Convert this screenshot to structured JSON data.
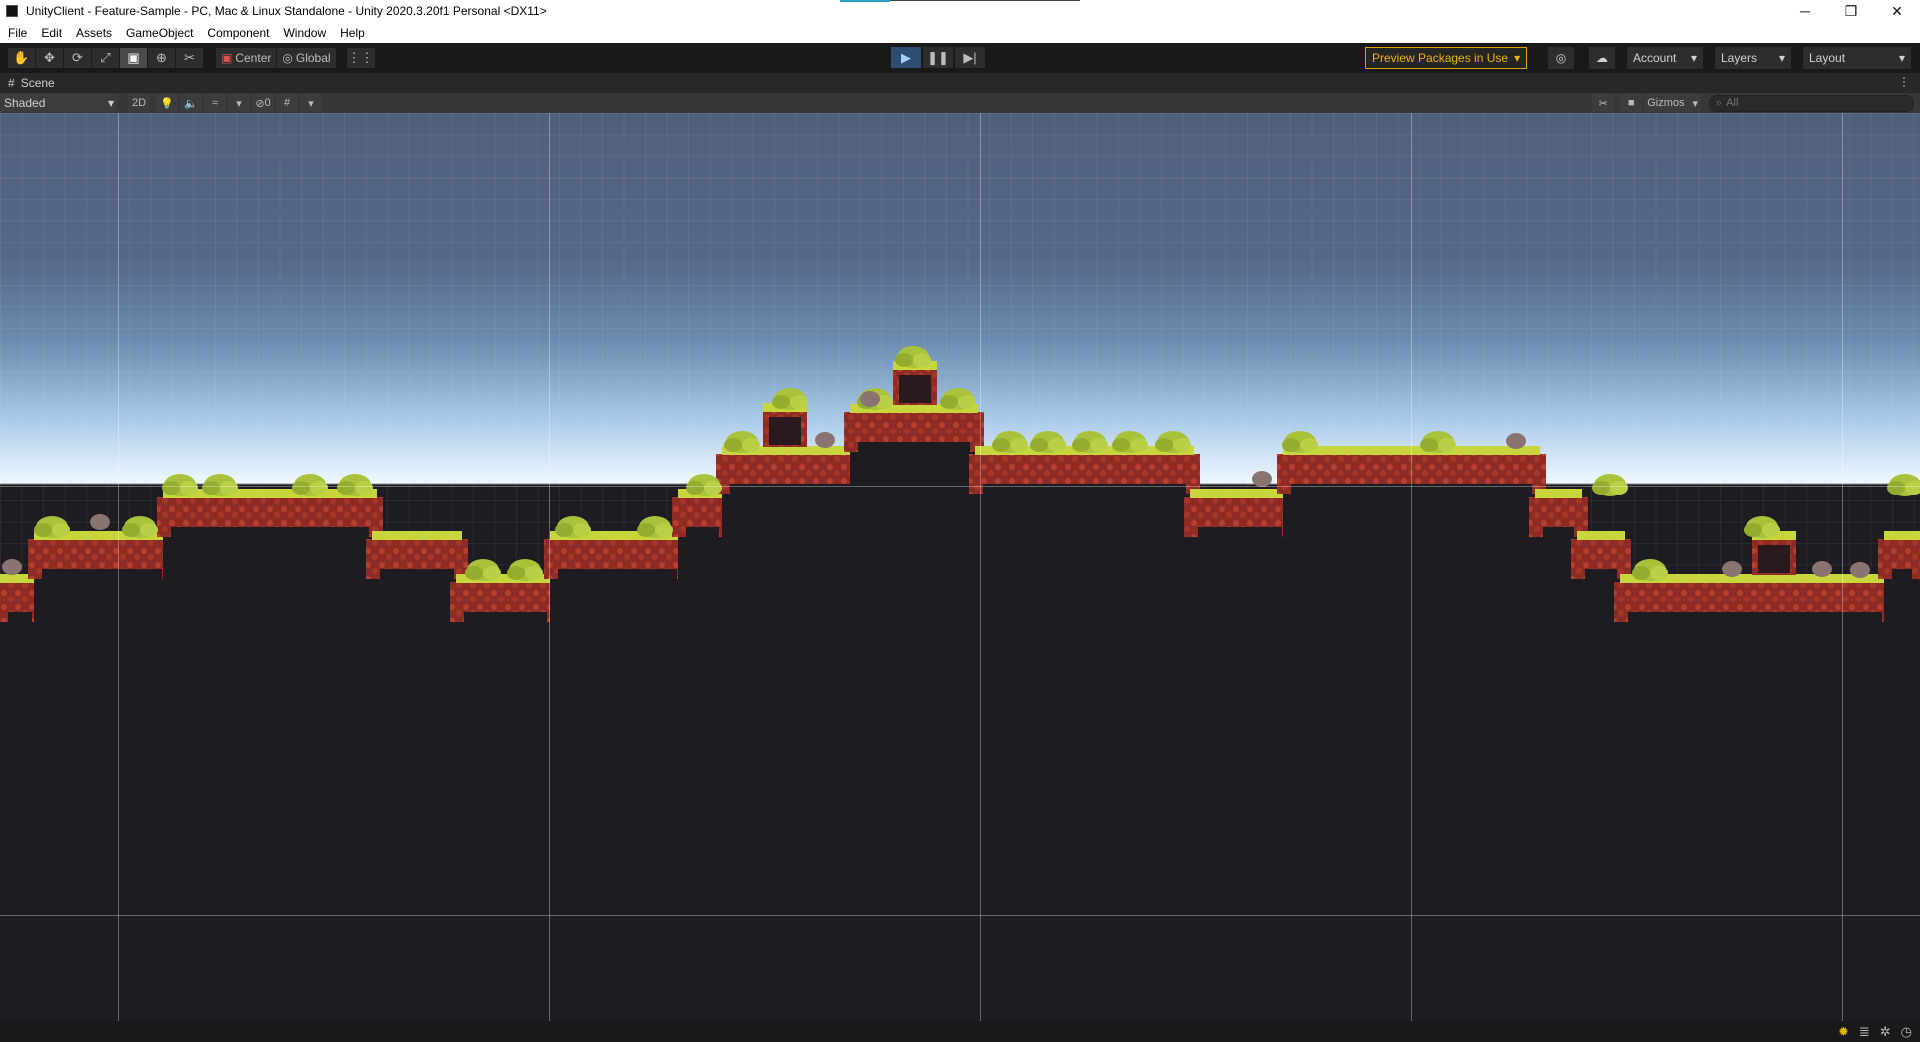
{
  "window": {
    "title": "UnityClient - Feature-Sample - PC, Mac & Linux Standalone - Unity 2020.3.20f1 Personal <DX11>",
    "controls": {
      "minimize": "─",
      "maximize": "❐",
      "close": "✕"
    }
  },
  "menu": {
    "items": [
      "File",
      "Edit",
      "Assets",
      "GameObject",
      "Component",
      "Window",
      "Help"
    ]
  },
  "toolbar": {
    "tools": [
      {
        "name": "hand-tool-icon",
        "glyph": "✋"
      },
      {
        "name": "move-tool-icon",
        "glyph": "✥"
      },
      {
        "name": "rotate-tool-icon",
        "glyph": "⟳"
      },
      {
        "name": "scale-tool-icon",
        "glyph": "⤢"
      },
      {
        "name": "rect-tool-icon",
        "glyph": "▣"
      },
      {
        "name": "transform-tool-icon",
        "glyph": "⊕"
      },
      {
        "name": "custom-tool-icon",
        "glyph": "✂"
      }
    ],
    "selected_tool": 4,
    "pivot_label": "Center",
    "space_label": "Global",
    "snap_glyph": "⋮⋮",
    "play_glyph": "▶",
    "pause_glyph": "❚❚",
    "step_glyph": "▶|",
    "preview_packages": "Preview Packages in Use",
    "account": "Account",
    "layers": "Layers",
    "layout": "Layout",
    "dropdown_glyph": "▾",
    "collab_glyph": "◎",
    "cloud_glyph": "☁"
  },
  "scene": {
    "tab_label": "Scene",
    "tab_glyph": "#",
    "more_glyph": "⋮",
    "shading_mode": "Shaded",
    "mode_2d": "2D",
    "light_glyph": "💡",
    "audio_glyph": "🔈",
    "fx_glyph": "≈",
    "hidden_count": "0",
    "hidden_glyph": "⊘",
    "grid_glyph": "#",
    "tools_glyph": "✂",
    "camera_glyph": "■",
    "gizmos_label": "Gizmos",
    "search_placeholder": "All",
    "search_glyph": "⌕"
  },
  "status": {
    "icons": [
      "lightbulb-icon",
      "cache-icon",
      "bug-icon",
      "progress-icon"
    ],
    "glyphs": [
      "✹",
      "≣",
      "✲",
      "◷"
    ]
  },
  "colors": {
    "grass": "#c7d63c",
    "dirt": "#a9382c",
    "dark_ground": "#1e1b21",
    "bush": "#a8c23b",
    "accent_warning": "#f0b400",
    "play_active": "#2f4d70"
  }
}
